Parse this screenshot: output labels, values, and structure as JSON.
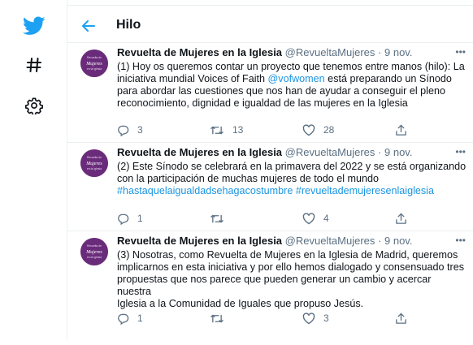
{
  "header": {
    "back_icon": "arrow-left-icon",
    "title": "Hilo"
  },
  "sidebar": {
    "icons": [
      "twitter-bird-icon",
      "hashtag-icon",
      "gear-icon"
    ]
  },
  "colors": {
    "accent": "#1da1f2",
    "link": "#1b95e0",
    "muted": "#5b7083",
    "avatar": "#6a2c7a"
  },
  "avatar": {
    "line1": "Revuelta de",
    "line2": "Mujeres",
    "line3": "en la Iglesia"
  },
  "tweets": [
    {
      "author": "Revuelta de Mujeres en la Iglesia",
      "handle": "@RevueltaMujeres",
      "sep": "·",
      "time": "9 nov.",
      "line1": "(1) Hoy os queremos contar un proyecto que tenemos entre manos (hilo): La",
      "line2a": "iniciativa mundial Voices of Faith ",
      "mention": "@vofwomen",
      "line2b": " está preparando un Sínodo",
      "line3": "para abordar las cuestiones que nos han de ayudar a conseguir el pleno",
      "line4": "reconocimiento, dignidad e igualdad de las mujeres en la Iglesia",
      "replies": "3",
      "retweets": "13",
      "likes": "28"
    },
    {
      "author": "Revuelta de Mujeres en la Iglesia",
      "handle": "@RevueltaMujeres",
      "sep": "·",
      "time": "9 nov.",
      "line1": "(2) Este Sínodo se celebrará en la primavera del 2022 y se está organizando",
      "line2": "con la participación de muchas mujeres de todo el mundo",
      "hashtag1": "#hastaquelaigualdadsehagacostumbre",
      "hashtag2": "#revueltademujeresenlaiglesia",
      "replies": "1",
      "retweets": "",
      "likes": "4"
    },
    {
      "author": "Revuelta de Mujeres en la Iglesia",
      "handle": "@RevueltaMujeres",
      "sep": "·",
      "time": "9 nov.",
      "line1": "(3) Nosotras, como Revuelta de Mujeres en la Iglesia de Madrid, queremos",
      "line2": "implicarnos en esta iniciativa y por ello hemos dialogado y consensuado tres",
      "line3": "propuestas que nos parece que pueden generar un cambio y acercar nuestra",
      "line4": "Iglesia a la Comunidad de Iguales que propuso Jesús.",
      "replies": "1",
      "retweets": "",
      "likes": "3"
    }
  ]
}
